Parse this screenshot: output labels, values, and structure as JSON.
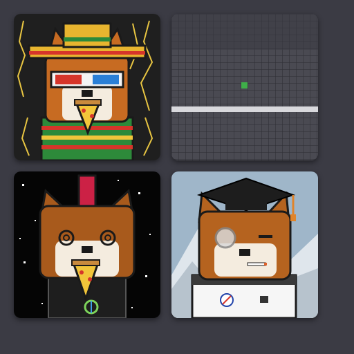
{
  "gallery": {
    "cards": [
      {
        "id": "card-1",
        "subject": "shiba-sombrero-3d-glasses-pizza",
        "background": "#1f1f1f",
        "accent": "#e8b52f"
      },
      {
        "id": "card-2",
        "subject": "pixel-grid-placeholder",
        "background": "#47474f",
        "accent": "#3fae49"
      },
      {
        "id": "card-3",
        "subject": "shiba-mohawk-space-pizza",
        "background": "#050505",
        "accent": "#cc2145"
      },
      {
        "id": "card-4",
        "subject": "shiba-graduation-cap-astronaut",
        "background": "#9fb6c9",
        "accent": "#1d1d1d"
      }
    ]
  },
  "colors": {
    "page_background": "#3b3b44",
    "fur": "#c76b22",
    "fur_dark": "#8a4410",
    "cream": "#f4ecdf",
    "outline": "#1a1a1a"
  }
}
